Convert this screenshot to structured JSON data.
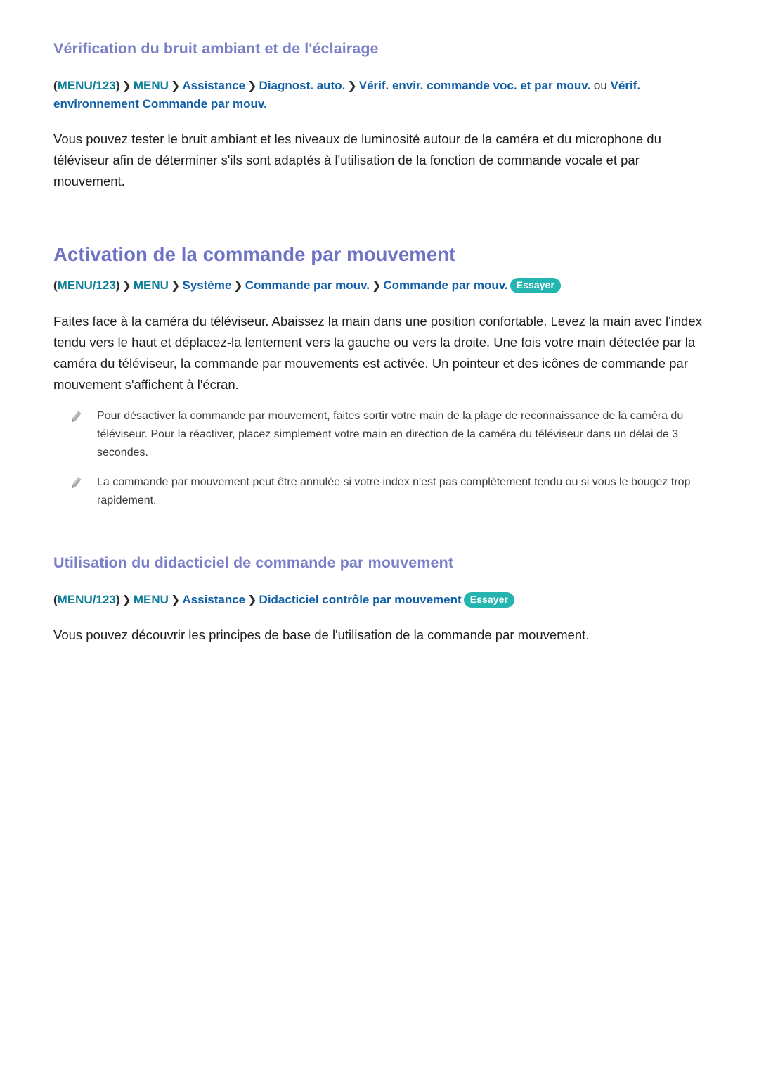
{
  "colors": {
    "heading_purple": "#7b7fc7",
    "heading_main_purple": "#6f73c6",
    "menu_teal": "#0e7e98",
    "menu_blue": "#105fa8",
    "badge_teal": "#25b5b0",
    "body_text": "#1e1e1e",
    "note_text": "#3b3b3b",
    "page_background": "#ffffff"
  },
  "section_one": {
    "heading": "Vérification du bruit ambiant et de l'éclairage",
    "menu_path": {
      "open_paren": "(",
      "menu123": "MENU/123",
      "close_paren": ")",
      "chevron": "❯",
      "menu": "MENU",
      "item1": "Assistance",
      "item2": "Diagnost. auto.",
      "item3": "Vérif. envir. commande voc. et par mouv.",
      "conjunction": "ou",
      "item4": "Vérif. environnement Commande par mouv."
    },
    "paragraph": "Vous pouvez tester le bruit ambiant et les niveaux de luminosité autour de la caméra et du microphone du téléviseur afin de déterminer s'ils sont adaptés à l'utilisation de la fonction de commande vocale et par mouvement."
  },
  "section_two": {
    "heading": "Activation de la commande par mouvement",
    "menu_path": {
      "open_paren": "(",
      "menu123": "MENU/123",
      "close_paren": ")",
      "chevron": "❯",
      "menu": "MENU",
      "item1": "Système",
      "item2": "Commande par mouv.",
      "item3": "Commande par mouv.",
      "try_badge": "Essayer"
    },
    "paragraph": "Faites face à la caméra du téléviseur. Abaissez la main dans une position confortable. Levez la main avec l'index tendu vers le haut et déplacez-la lentement vers la gauche ou vers la droite. Une fois votre main détectée par la caméra du téléviseur, la commande par mouvements est activée. Un pointeur et des icônes de commande par mouvement s'affichent à l'écran.",
    "notes": [
      {
        "icon": "pencil-icon",
        "text": "Pour désactiver la commande par mouvement, faites sortir votre main de la plage de reconnaissance de la caméra du téléviseur. Pour la réactiver, placez simplement votre main en direction de la caméra du téléviseur dans un délai de 3 secondes."
      },
      {
        "icon": "pencil-icon",
        "text": "La commande par mouvement peut être annulée si votre index n'est pas complètement tendu ou si vous le bougez trop rapidement."
      }
    ]
  },
  "section_three": {
    "heading": "Utilisation du didacticiel de commande par mouvement",
    "menu_path": {
      "open_paren": "(",
      "menu123": "MENU/123",
      "close_paren": ")",
      "chevron": "❯",
      "menu": "MENU",
      "item1": "Assistance",
      "item2": "Didacticiel contrôle par mouvement",
      "try_badge": "Essayer"
    },
    "paragraph": "Vous pouvez découvrir les principes de base de l'utilisation de la commande par mouvement."
  }
}
